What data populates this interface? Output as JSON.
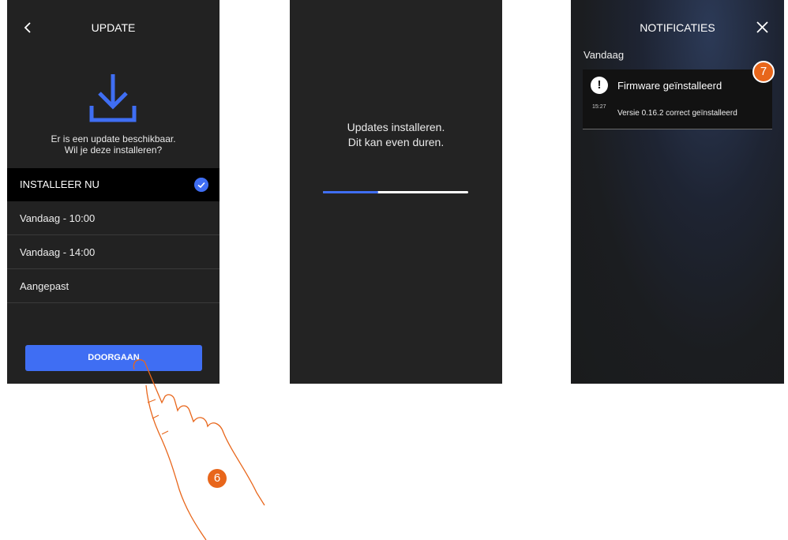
{
  "screen1": {
    "title": "UPDATE",
    "back_icon": "chevron-left-icon",
    "icon": "download-icon",
    "prompt_line1": "Er is een update beschikbaar.",
    "prompt_line2": "Wil je deze installeren?",
    "options": [
      {
        "label": "INSTALLEER NU",
        "selected": true
      },
      {
        "label": "Vandaag - 10:00",
        "selected": false
      },
      {
        "label": "Vandaag - 14:00",
        "selected": false
      },
      {
        "label": "Aangepast",
        "selected": false
      }
    ],
    "continue_label": "DOORGAAN"
  },
  "screen2": {
    "line1": "Updates installeren.",
    "line2": "Dit kan even duren.",
    "progress": 0.38
  },
  "screen3": {
    "title": "NOTIFICATIES",
    "close_icon": "close-icon",
    "section": "Vandaag",
    "notification": {
      "icon": "alert-icon",
      "title": "Firmware geïnstalleerd",
      "time": "15:27",
      "message": "Versie 0.16.2  correct geïnstalleerd"
    }
  },
  "callouts": {
    "step6": "6",
    "step7": "7"
  },
  "colors": {
    "accent": "#3f6ef3",
    "callout": "#e8661b",
    "screen_bg": "#222222"
  }
}
